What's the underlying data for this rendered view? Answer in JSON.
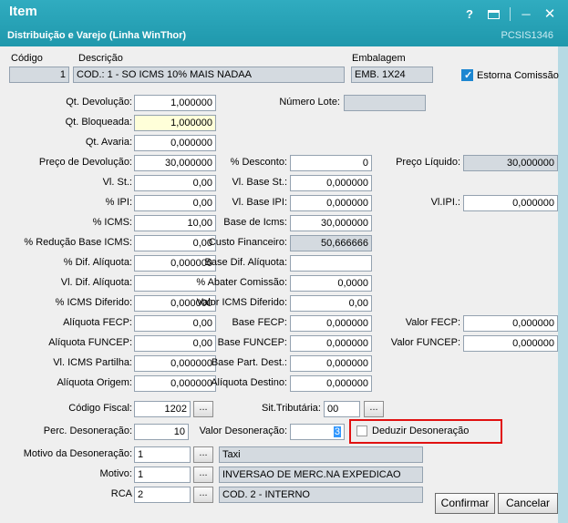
{
  "window": {
    "title": "Item",
    "subtitle": "Distribuição e Varejo (Linha WinThor)",
    "program_code": "PCSIS1346",
    "icons": {
      "help": "?",
      "maximize": "maximize-window",
      "minimize": "─",
      "close": "✕"
    },
    "colors": {
      "titlebar": "#25A2B6",
      "readonly_field": "#D4DAE0",
      "highlight_field": "#FFFFD9",
      "selection": "#3297FD",
      "annotation_box": "#E11111",
      "checkbox_accent": "#1C86D1"
    }
  },
  "header": {
    "codigo": {
      "label": "Código",
      "value": "1"
    },
    "descricao": {
      "label": "Descrição",
      "value": "COD.: 1 - SO ICMS 10% MAIS NADAA"
    },
    "embalagem": {
      "label": "Embalagem",
      "value": "EMB. 1X24"
    },
    "estorna_comissao": {
      "label": "Estorna Comissão",
      "checked": true
    }
  },
  "fields": {
    "qt_devolucao": {
      "label": "Qt. Devolução:",
      "value": "1,000000"
    },
    "numero_lote": {
      "label": "Número Lote:",
      "value": ""
    },
    "qt_bloqueada": {
      "label": "Qt. Bloqueada:",
      "value": "1,000000"
    },
    "qt_avaria": {
      "label": "Qt. Avaria:",
      "value": "0,000000"
    },
    "preco_devolucao": {
      "label": "Preço de Devolução:",
      "value": "30,000000"
    },
    "perc_desconto": {
      "label": "% Desconto:",
      "value": "0"
    },
    "preco_liquido": {
      "label": "Preço Líquido:",
      "value": "30,000000"
    },
    "vl_st": {
      "label": "Vl. St.:",
      "value": "0,00"
    },
    "vl_base_st": {
      "label": "Vl. Base St.:",
      "value": "0,000000"
    },
    "perc_ipi": {
      "label": "% IPI:",
      "value": "0,00"
    },
    "vl_base_ipi": {
      "label": "Vl. Base IPI:",
      "value": "0,000000"
    },
    "vl_ipi": {
      "label": "Vl.IPI.:",
      "value": "0,000000"
    },
    "perc_icms": {
      "label": "% ICMS:",
      "value": "10,00"
    },
    "base_icms": {
      "label": "Base de Icms:",
      "value": "30,000000"
    },
    "perc_reducao_base_icms": {
      "label": "% Redução Base ICMS:",
      "value": "0,00"
    },
    "custo_financeiro": {
      "label": "Custo Financeiro:",
      "value": "50,666666"
    },
    "perc_dif_aliquota": {
      "label": "% Dif. Alíquota:",
      "value": "0,000000"
    },
    "base_dif_aliquota": {
      "label": "Base Dif. Alíquota:",
      "value": ""
    },
    "vl_dif_aliquota": {
      "label": "Vl. Dif. Alíquota:",
      "value": ""
    },
    "perc_abater_comissao": {
      "label": "% Abater Comissão:",
      "value": "0,0000"
    },
    "perc_icms_diferido": {
      "label": "% ICMS Diferido:",
      "value": "0,000000"
    },
    "valor_icms_diferido": {
      "label": "Valor ICMS Diferido:",
      "value": "0,00"
    },
    "aliquota_fecp": {
      "label": "Alíquota FECP:",
      "value": "0,00"
    },
    "base_fecp": {
      "label": "Base FECP:",
      "value": "0,000000"
    },
    "valor_fecp": {
      "label": "Valor FECP:",
      "value": "0,000000"
    },
    "aliquota_funcep": {
      "label": "Alíquota FUNCEP:",
      "value": "0,00"
    },
    "base_funcep": {
      "label": "Base FUNCEP:",
      "value": "0,000000"
    },
    "valor_funcep": {
      "label": "Valor FUNCEP:",
      "value": "0,000000"
    },
    "vl_icms_partilha": {
      "label": "Vl. ICMS Partilha:",
      "value": "0,000000"
    },
    "base_part_dest": {
      "label": "Base Part. Dest.:",
      "value": "0,000000"
    },
    "aliquota_origem": {
      "label": "Alíquota Origem:",
      "value": "0,000000"
    },
    "aliquota_destino": {
      "label": "Alíquota Destino:",
      "value": "0,000000"
    }
  },
  "fiscal": {
    "codigo_fiscal": {
      "label": "Código Fiscal:",
      "value": "1202"
    },
    "sit_tributaria": {
      "label": "Sit.Tributária:",
      "value": "00"
    }
  },
  "desoneracao": {
    "perc": {
      "label": "Perc. Desoneração:",
      "value": "10"
    },
    "valor": {
      "label": "Valor Desoneração:",
      "value": "3"
    },
    "deduzir": {
      "label": "Deduzir Desoneração",
      "checked": false
    }
  },
  "motivos": {
    "motivo_desoneracao": {
      "label": "Motivo da Desoneração:",
      "value": "1",
      "text": "Taxi"
    },
    "motivo": {
      "label": "Motivo:",
      "value": "1",
      "text": "INVERSAO DE MERC.NA EXPEDICAO"
    },
    "rca": {
      "label": "RCA",
      "value": "2",
      "text": "COD. 2 - INTERNO"
    }
  },
  "buttons": {
    "confirmar": "Confirmar",
    "cancelar": "Cancelar"
  },
  "dots": "..."
}
